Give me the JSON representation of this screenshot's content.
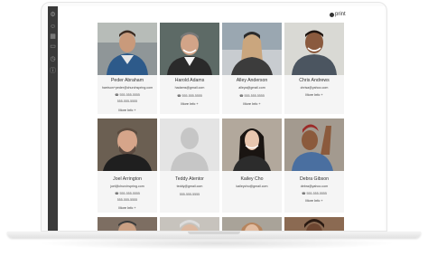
{
  "toolbar": {
    "print_label": "print"
  },
  "people": [
    {
      "name": "Peder Abraham",
      "email": "harrison+peder@churchspring.com",
      "phones": [
        "555-555-5555",
        "555-555-5555"
      ],
      "more": "More Info +"
    },
    {
      "name": "Harold Adams",
      "email": "hadams@gmail.com",
      "phones": [
        "555-555-5555"
      ],
      "more": "More Info +"
    },
    {
      "name": "Alley Anderson",
      "email": "alleya@gmail.com",
      "phones": [
        "555-555-5555"
      ],
      "more": "More Info +"
    },
    {
      "name": "Chris Andrews",
      "email": "chrisa@yahoo.com",
      "phones": [],
      "more": "More Info +"
    },
    {
      "name": "Joel Arrington",
      "email": "joel@churchspring.com",
      "phones": [
        "555-555-5555",
        "555-555-5555"
      ],
      "more": "More Info +"
    },
    {
      "name": "Teddy Atentor",
      "email": "teddy@gmail.com",
      "phones": [
        "555-555-5555"
      ],
      "more": ""
    },
    {
      "name": "Kailey Cho",
      "email": "kaileycho@gmail.com",
      "phones": [],
      "more": ""
    },
    {
      "name": "Debra Gibson",
      "email": "debra@yahoo.com",
      "phones": [
        "555-555-5555"
      ],
      "more": "More Info +"
    }
  ]
}
